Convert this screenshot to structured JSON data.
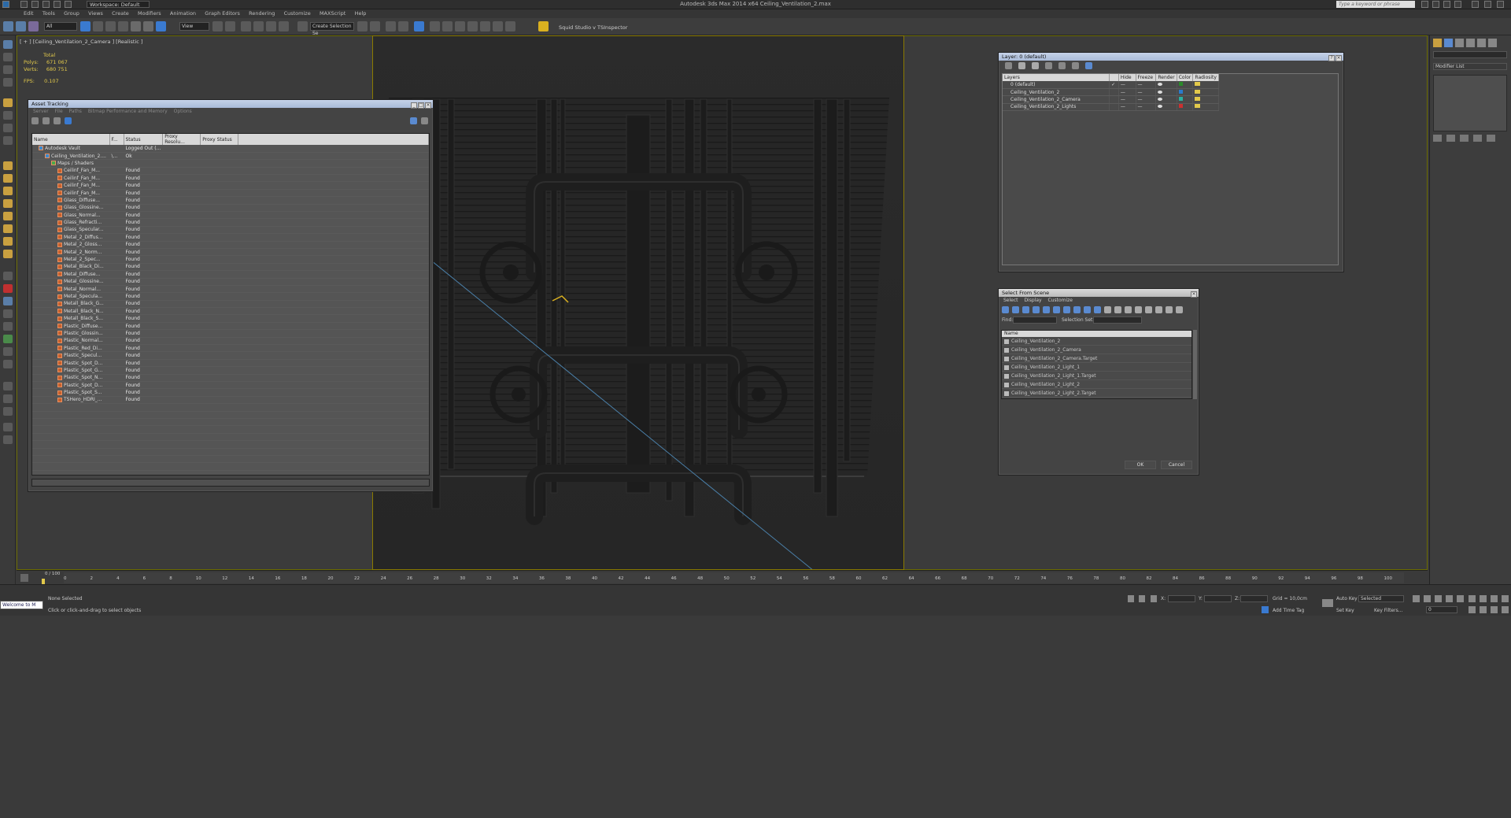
{
  "app": {
    "title": "Autodesk 3ds Max  2014 x64     Ceiling_Ventilation_2.max",
    "workspace": "Workspace: Default",
    "search_placeholder": "Type a keyword or phrase"
  },
  "menu": [
    "Edit",
    "Tools",
    "Group",
    "Views",
    "Create",
    "Modifiers",
    "Animation",
    "Graph Editors",
    "Rendering",
    "Customize",
    "MAXScript",
    "Help"
  ],
  "toolbar": {
    "filter": "All",
    "view": "View",
    "create_selection_set": "Create Selection Se",
    "plugin_1": "Squid Studio v",
    "plugin_2": "TSInspector"
  },
  "viewport": {
    "label": "[ + ] [Ceiling_Ventilation_2_Camera ] [Realistic ]",
    "stats": {
      "total_label": "Total",
      "polys_label": "Polys:",
      "polys": "671 067",
      "verts_label": "Verts:",
      "verts": "680 751",
      "fps_label": "FPS:",
      "fps": "0.107"
    },
    "axis_labels": [
      "x",
      "y",
      "z"
    ]
  },
  "asset_tracking": {
    "title": "Asset Tracking",
    "menu": [
      "Server",
      "File",
      "Paths",
      "Bitmap Performance and Memory",
      "Options"
    ],
    "columns": [
      "Name",
      "F...",
      "Status",
      "Proxy Resolu...",
      "Proxy Status"
    ],
    "rows": [
      {
        "name": "Autodesk Vault",
        "f": "",
        "status": "Logged Out (...",
        "indent": 1
      },
      {
        "name": "Ceiling_Ventilation_2....",
        "f": "\\...",
        "status": "Ok",
        "indent": 2
      },
      {
        "name": "Maps / Shaders",
        "f": "",
        "status": "",
        "indent": 3
      },
      {
        "name": "Ceilinf_Fan_M...",
        "f": "",
        "status": "Found",
        "indent": 4
      },
      {
        "name": "Ceilinf_Fan_M...",
        "f": "",
        "status": "Found",
        "indent": 4
      },
      {
        "name": "Ceilinf_Fan_M...",
        "f": "",
        "status": "Found",
        "indent": 4
      },
      {
        "name": "Ceilinf_Fan_M...",
        "f": "",
        "status": "Found",
        "indent": 4
      },
      {
        "name": "Glass_Diffuse...",
        "f": "",
        "status": "Found",
        "indent": 4
      },
      {
        "name": "Glass_Glossine...",
        "f": "",
        "status": "Found",
        "indent": 4
      },
      {
        "name": "Glass_Normal...",
        "f": "",
        "status": "Found",
        "indent": 4
      },
      {
        "name": "Glass_Refracti...",
        "f": "",
        "status": "Found",
        "indent": 4
      },
      {
        "name": "Glass_Specular...",
        "f": "",
        "status": "Found",
        "indent": 4
      },
      {
        "name": "Metal_2_Diffus...",
        "f": "",
        "status": "Found",
        "indent": 4
      },
      {
        "name": "Metal_2_Gloss...",
        "f": "",
        "status": "Found",
        "indent": 4
      },
      {
        "name": "Metal_2_Norm...",
        "f": "",
        "status": "Found",
        "indent": 4
      },
      {
        "name": "Metal_2_Spec...",
        "f": "",
        "status": "Found",
        "indent": 4
      },
      {
        "name": "Metal_Black_Di...",
        "f": "",
        "status": "Found",
        "indent": 4
      },
      {
        "name": "Metal_Diffuse...",
        "f": "",
        "status": "Found",
        "indent": 4
      },
      {
        "name": "Metal_Glossine...",
        "f": "",
        "status": "Found",
        "indent": 4
      },
      {
        "name": "Metal_Normal...",
        "f": "",
        "status": "Found",
        "indent": 4
      },
      {
        "name": "Metal_Specula...",
        "f": "",
        "status": "Found",
        "indent": 4
      },
      {
        "name": "Metall_Black_G...",
        "f": "",
        "status": "Found",
        "indent": 4
      },
      {
        "name": "Metall_Black_N...",
        "f": "",
        "status": "Found",
        "indent": 4
      },
      {
        "name": "Metall_Black_S...",
        "f": "",
        "status": "Found",
        "indent": 4
      },
      {
        "name": "Plastic_Diffuse...",
        "f": "",
        "status": "Found",
        "indent": 4
      },
      {
        "name": "Plastic_Glossin...",
        "f": "",
        "status": "Found",
        "indent": 4
      },
      {
        "name": "Plastic_Normal...",
        "f": "",
        "status": "Found",
        "indent": 4
      },
      {
        "name": "Plastic_Red_Di...",
        "f": "",
        "status": "Found",
        "indent": 4
      },
      {
        "name": "Plastic_Specul...",
        "f": "",
        "status": "Found",
        "indent": 4
      },
      {
        "name": "Plastic_Spot_D...",
        "f": "",
        "status": "Found",
        "indent": 4
      },
      {
        "name": "Plastic_Spot_G...",
        "f": "",
        "status": "Found",
        "indent": 4
      },
      {
        "name": "Plastic_Spot_N...",
        "f": "",
        "status": "Found",
        "indent": 4
      },
      {
        "name": "Plastic_Spot_D...",
        "f": "",
        "status": "Found",
        "indent": 4
      },
      {
        "name": "Plastic_Spot_S...",
        "f": "",
        "status": "Found",
        "indent": 4
      },
      {
        "name": "TSHero_HDRI_...",
        "f": "",
        "status": "Found",
        "indent": 4
      }
    ]
  },
  "layer_manager": {
    "title": "Layer: 0 (default)",
    "columns": [
      "Layers",
      "",
      "Hide",
      "Freeze",
      "Render",
      "Color",
      "Radiosity"
    ],
    "rows": [
      {
        "name": "0 (default)",
        "check": "✓",
        "color": "#2a8a2a"
      },
      {
        "name": "Ceiling_Ventilation_2",
        "check": "",
        "color": "#2a7acc"
      },
      {
        "name": "Ceiling_Ventilation_2_Camera",
        "check": "",
        "color": "#2ab0a0"
      },
      {
        "name": "Ceiling_Ventilation_2_Lights",
        "check": "",
        "color": "#cc3030"
      }
    ],
    "hide_val": "—",
    "freeze_val": "—"
  },
  "select_from_scene": {
    "title": "Select From Scene",
    "menu": [
      "Select",
      "Display",
      "Customize"
    ],
    "find_label": "Find:",
    "selection_set_label": "Selection Set:",
    "name_header": "Name",
    "items": [
      "Ceiling_Ventilation_2",
      "Ceiling_Ventilation_2_Camera",
      "Ceiling_Ventilation_2_Camera.Target",
      "Ceiling_Ventilation_2_Light_1",
      "Ceiling_Ventilation_2_Light_1.Target",
      "Ceiling_Ventilation_2_Light_2",
      "Ceiling_Ventilation_2_Light_2.Target"
    ],
    "ok": "OK",
    "cancel": "Cancel"
  },
  "command_panel": {
    "modifier_list": "Modifier List"
  },
  "timeline": {
    "frame": "0 / 100",
    "ticks": [
      "0",
      "2",
      "4",
      "6",
      "8",
      "10",
      "12",
      "14",
      "16",
      "18",
      "20",
      "22",
      "24",
      "26",
      "28",
      "30",
      "32",
      "34",
      "36",
      "38",
      "40",
      "42",
      "44",
      "46",
      "48",
      "50",
      "52",
      "54",
      "56",
      "58",
      "60",
      "62",
      "64",
      "66",
      "68",
      "70",
      "72",
      "74",
      "76",
      "78",
      "80",
      "82",
      "84",
      "86",
      "88",
      "90",
      "92",
      "94",
      "96",
      "98",
      "100"
    ]
  },
  "status": {
    "maxscript": "Welcome to M",
    "selection": "None Selected",
    "prompt": "Click or click-and-drag to select objects",
    "x_label": "X:",
    "y_label": "Y:",
    "z_label": "Z:",
    "grid": "Grid = 10,0cm",
    "add_time_tag": "Add Time Tag",
    "auto_key": "Auto Key",
    "selected": "Selected",
    "set_key": "Set Key",
    "key_filters": "Key Filters...",
    "frame_value": "0"
  }
}
